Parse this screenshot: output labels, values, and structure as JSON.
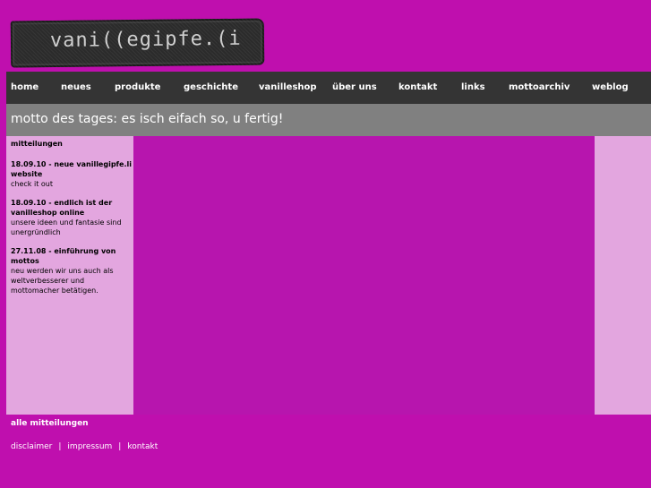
{
  "logo": {
    "text": "vani((egipfe.(i"
  },
  "nav": {
    "items": [
      {
        "label": "home"
      },
      {
        "label": "neues"
      },
      {
        "label": "produkte"
      },
      {
        "label": "geschichte"
      },
      {
        "label": "vanilleshop"
      },
      {
        "label": "über uns"
      },
      {
        "label": "kontakt"
      },
      {
        "label": "links"
      },
      {
        "label": "mottoarchiv"
      },
      {
        "label": "weblog"
      }
    ]
  },
  "motto": {
    "text": "motto des tages: es isch eifach so, u fertig!"
  },
  "sidebar": {
    "heading": "mitteilungen",
    "news": [
      {
        "title": "18.09.10 -  neue vanillegipfe.li website",
        "body": "check it out"
      },
      {
        "title": "18.09.10 -  endlich ist der vanilleshop online",
        "body": "unsere ideen und fantasie sind unergründlich"
      },
      {
        "title": "27.11.08 -  einführung von mottos",
        "body": "neu werden wir uns auch als weltverbesserer und mottomacher betätigen."
      }
    ]
  },
  "all_news": "alle mitteilungen",
  "footer": {
    "links": [
      {
        "label": "disclaimer"
      },
      {
        "label": "impressum"
      },
      {
        "label": "kontakt"
      }
    ],
    "separator": "|"
  },
  "colors": {
    "background": "#bf0fae",
    "nav_bg": "#343434",
    "motto_bg": "#808080",
    "sidebar_bg": "#e3a6df",
    "content_bg": "#b715ae"
  }
}
